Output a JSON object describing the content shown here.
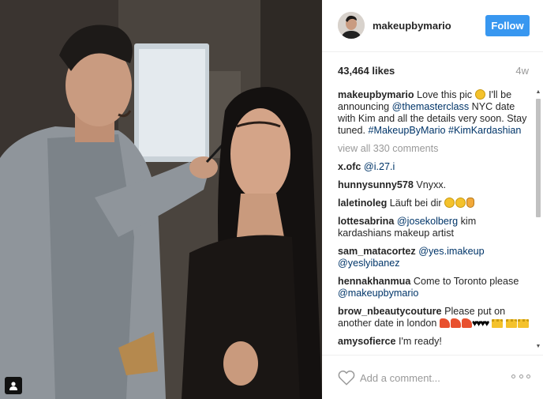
{
  "post": {
    "username": "makeupbymario",
    "follow_label": "Follow",
    "likes": "43,464 likes",
    "age": "4w",
    "caption_user": "makeupbymario",
    "caption_parts": [
      "Love this pic ",
      " I'll be announcing ",
      "@themasterclass",
      " NYC date with Kim and all the details very soon. Stay tuned. ",
      "#MakeupByMario",
      " ",
      "#KimKardashian"
    ],
    "view_all": "view all 330 comments"
  },
  "comments": [
    {
      "user": "x.ofc",
      "mention": "@i.27.i"
    },
    {
      "user": "hunnysunny578",
      "text": "Vnyxx."
    },
    {
      "user": "laletinoleg",
      "text": "Läuft bei dir"
    },
    {
      "user": "lottesabrina",
      "mention": "@josekolberg",
      "text": " kim kardashians makeup artist"
    },
    {
      "user": "sam_matacortez",
      "mention": "@yes.imakeup",
      "mention2": "@yeslyibanez"
    },
    {
      "user": "hennakhanmua",
      "text": "Come to Toronto please ",
      "mention": "@makeupbymario"
    },
    {
      "user": "brow_nbeautycouture",
      "text": "Please put on another date in london "
    },
    {
      "user": "amysofierce",
      "text": "I'm ready!"
    }
  ],
  "footer": {
    "placeholder": "Add a comment..."
  },
  "icons": {
    "like": "heart-outline-icon",
    "more": "more-options-icon",
    "tag": "user-tag-icon"
  },
  "colors": {
    "follow_button": "#3897f0",
    "link": "#003569",
    "muted": "#999999"
  }
}
